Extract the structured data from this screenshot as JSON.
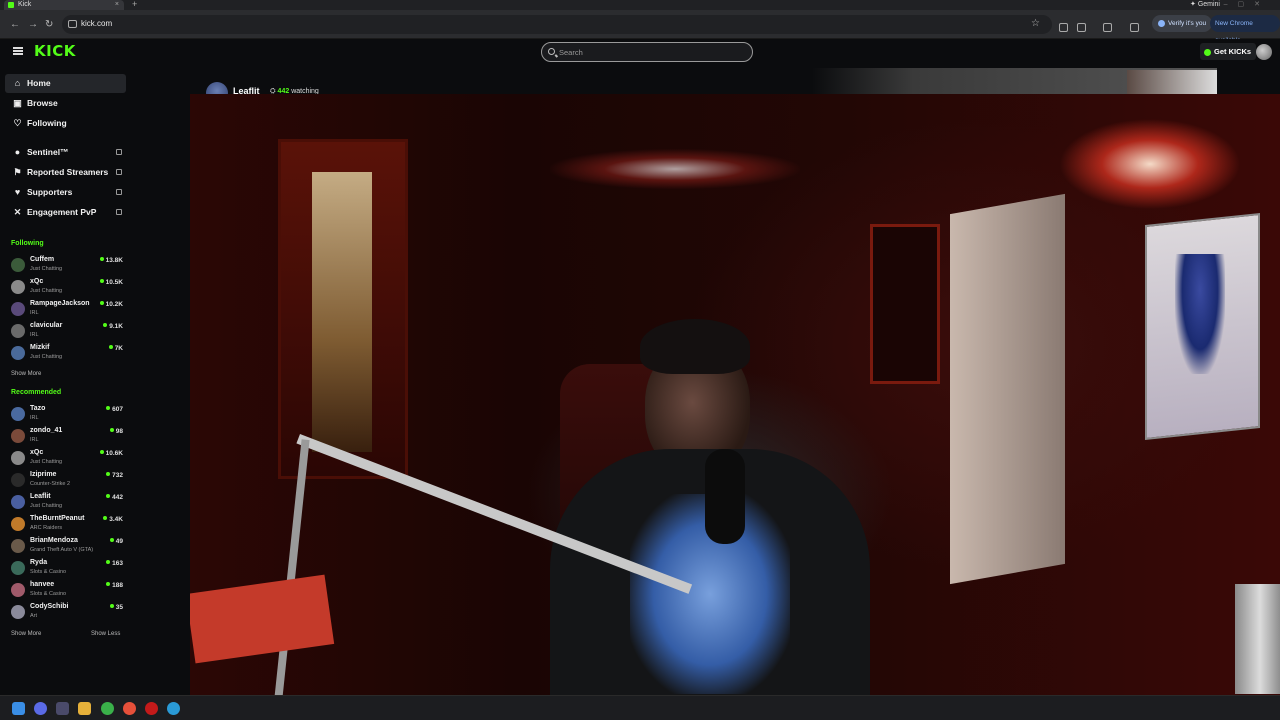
{
  "browser": {
    "tab_title": "Kick",
    "url": "kick.com",
    "gemini_label": "Gemini",
    "verify_label": "Verify it's you",
    "update_label": "New Chrome available"
  },
  "header": {
    "logo": "KICK",
    "search_placeholder": "Search",
    "get_kicks_label": "Get KICKs"
  },
  "sidebar": {
    "nav": [
      {
        "label": "Home",
        "icon": "home-icon"
      },
      {
        "label": "Browse",
        "icon": "browse-icon"
      },
      {
        "label": "Following",
        "icon": "heart-icon"
      }
    ],
    "mod_nav": [
      {
        "label": "Sentinel™",
        "icon": "shield-icon"
      },
      {
        "label": "Reported Streamers",
        "icon": "flag-icon"
      },
      {
        "label": "Supporters",
        "icon": "heart-icon"
      },
      {
        "label": "Engagement PvP",
        "icon": "swords-icon"
      }
    ],
    "following_title": "Following",
    "following": [
      {
        "name": "Cuffem",
        "category": "Just Chatting",
        "viewers": "13.8K",
        "color": "#3b5b3a"
      },
      {
        "name": "xQc",
        "category": "Just Chatting",
        "viewers": "10.5K",
        "color": "#8a8a8a"
      },
      {
        "name": "RampageJackson",
        "category": "IRL",
        "viewers": "10.2K",
        "color": "#5a4a7a"
      },
      {
        "name": "clavicular",
        "category": "IRL",
        "viewers": "9.1K",
        "color": "#6a6a6a"
      },
      {
        "name": "Mizkif",
        "category": "Just Chatting",
        "viewers": "7K",
        "color": "#4a6a9a"
      }
    ],
    "show_more": "Show More",
    "recommended_title": "Recommended",
    "recommended": [
      {
        "name": "Tazo",
        "category": "IRL",
        "viewers": "607",
        "color": "#4a6aa0"
      },
      {
        "name": "zondo_41",
        "category": "IRL",
        "viewers": "98",
        "color": "#7a4a3a"
      },
      {
        "name": "xQc",
        "category": "Just Chatting",
        "viewers": "10.6K",
        "color": "#8a8a8a"
      },
      {
        "name": "Iziprime",
        "category": "Counter-Strike 2",
        "viewers": "732",
        "color": "#2a2a2a"
      },
      {
        "name": "Leaflit",
        "category": "Just Chatting",
        "viewers": "442",
        "color": "#4a5fa0"
      },
      {
        "name": "TheBurntPeanut",
        "category": "ARC Raiders",
        "viewers": "3.4K",
        "color": "#c07a2a"
      },
      {
        "name": "BrianMendoza",
        "category": "Grand Theft Auto V (GTA)",
        "viewers": "49",
        "color": "#6a5a4a"
      },
      {
        "name": "Ryda",
        "category": "Slots & Casino",
        "viewers": "163",
        "color": "#3a6a5a"
      },
      {
        "name": "hanvee",
        "category": "Slots & Casino",
        "viewers": "188",
        "color": "#a05a6a"
      },
      {
        "name": "CodySchibi",
        "category": "Art",
        "viewers": "35",
        "color": "#8a8a9a"
      }
    ],
    "show_more_2": "Show More",
    "show_less": "Show Less"
  },
  "stream": {
    "streamer": "Leaflit",
    "viewers": "442",
    "watching_label": "watching"
  }
}
